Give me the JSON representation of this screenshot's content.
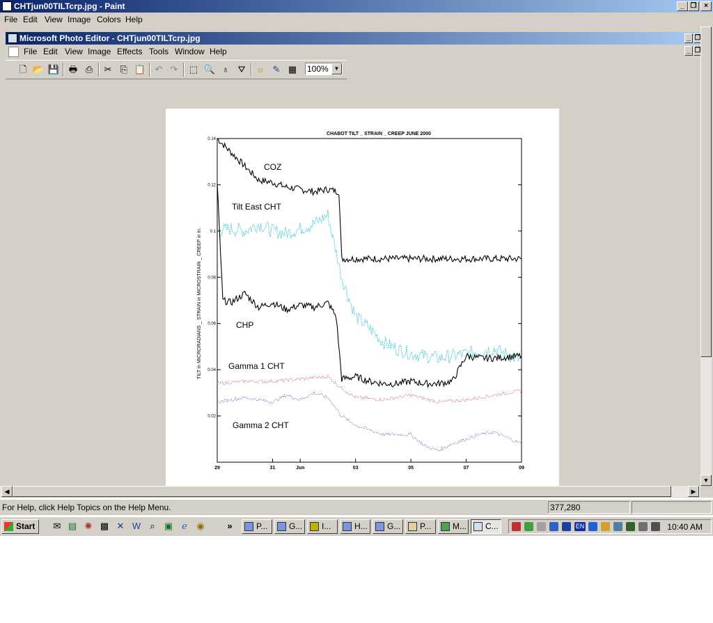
{
  "paint": {
    "title": "CHTjun00TILTcrp.jpg - Paint",
    "menu": [
      "File",
      "Edit",
      "View",
      "Image",
      "Colors",
      "Help"
    ]
  },
  "photo_editor": {
    "title": "Microsoft Photo Editor - CHTjun00TILTcrp.jpg",
    "menu": [
      "File",
      "Edit",
      "View",
      "Image",
      "Effects",
      "Tools",
      "Window",
      "Help"
    ],
    "zoom": "100%",
    "toolbar_icons": [
      "new-icon",
      "open-icon",
      "save-icon",
      "print-icon",
      "scan-icon",
      "cut-icon",
      "copy-icon",
      "paste-icon",
      "undo-icon",
      "redo-icon",
      "select-icon",
      "zoom-icon",
      "smudge-icon",
      "transparency-icon",
      "sharpen-icon",
      "pen-icon",
      "properties-icon"
    ]
  },
  "image": {
    "chart_data": {
      "type": "line",
      "title": "CHABOT TILT _ STRAIN _ CREEP   JUNE 2000",
      "ylabel": "TILT in MICRORADIANS _ STRAIN in MICROSTRAIN _ CREEP in in.",
      "xlabel": "",
      "ylim": [
        0,
        0.14
      ],
      "xlim": [
        29,
        39
      ],
      "yticks": [
        "0.14",
        "0.12",
        "0.1",
        "0.08",
        "0.06",
        "0.04",
        "0.02"
      ],
      "xticks": [
        {
          "x": 29,
          "label": "29"
        },
        {
          "x": 31,
          "label": "31"
        },
        {
          "x": 32,
          "label": "Jun"
        },
        {
          "x": 34,
          "label": "03"
        },
        {
          "x": 36,
          "label": "05"
        },
        {
          "x": 38,
          "label": "07"
        },
        {
          "x": 40,
          "label": "09"
        }
      ],
      "grid": false,
      "series": [
        {
          "name": "COZ",
          "color": "#000000",
          "style": "solid",
          "x": [
            29,
            29.5,
            30,
            30.5,
            31,
            31.5,
            32,
            32.5,
            33,
            33.4,
            33.5,
            34,
            35,
            36,
            37,
            38,
            39,
            40
          ],
          "y": [
            0.14,
            0.134,
            0.128,
            0.122,
            0.121,
            0.119,
            0.118,
            0.117,
            0.118,
            0.117,
            0.088,
            0.088,
            0.088,
            0.088,
            0.088,
            0.088,
            0.088,
            0.088
          ]
        },
        {
          "name": "Tilt East CHT",
          "color": "#40c8d8",
          "style": "dashed",
          "x": [
            29,
            29.5,
            30,
            30.5,
            31,
            31.5,
            32,
            32.5,
            33,
            33.5,
            34,
            34.5,
            35,
            35.5,
            36,
            36.5,
            37,
            37.5,
            38,
            38.5,
            39,
            40
          ],
          "y": [
            0.1,
            0.101,
            0.1,
            0.103,
            0.1,
            0.099,
            0.101,
            0.103,
            0.107,
            0.08,
            0.063,
            0.058,
            0.052,
            0.049,
            0.047,
            0.046,
            0.045,
            0.046,
            0.047,
            0.048,
            0.049,
            0.044
          ]
        },
        {
          "name": "CHP",
          "color": "#000000",
          "style": "solid",
          "x": [
            29,
            29.2,
            29.5,
            30,
            30.5,
            31,
            31.5,
            32,
            32.5,
            33,
            33.3,
            33.5,
            34,
            34.5,
            35,
            35.5,
            36,
            36.5,
            37,
            37.5,
            38,
            38.5,
            39,
            40
          ],
          "y": [
            0.12,
            0.07,
            0.069,
            0.073,
            0.067,
            0.069,
            0.066,
            0.068,
            0.067,
            0.069,
            0.063,
            0.036,
            0.037,
            0.035,
            0.034,
            0.034,
            0.035,
            0.034,
            0.034,
            0.035,
            0.046,
            0.045,
            0.045,
            0.046
          ]
        },
        {
          "name": "Gamma 1 CHT",
          "color": "#c04040",
          "style": "dotted",
          "x": [
            29,
            30,
            31,
            32,
            33,
            33.5,
            34,
            35,
            36,
            37,
            38,
            39,
            40
          ],
          "y": [
            0.034,
            0.035,
            0.035,
            0.036,
            0.037,
            0.032,
            0.028,
            0.027,
            0.029,
            0.026,
            0.027,
            0.029,
            0.031
          ]
        },
        {
          "name": "Gamma 2 CHT",
          "color": "#4050a0",
          "style": "dotted",
          "x": [
            29,
            30,
            31,
            31.5,
            32,
            32.5,
            33,
            33.5,
            34,
            35,
            36,
            36.5,
            37,
            37.5,
            38,
            38.5,
            39,
            40
          ],
          "y": [
            0.026,
            0.028,
            0.026,
            0.029,
            0.027,
            0.03,
            0.028,
            0.02,
            0.016,
            0.012,
            0.012,
            0.007,
            0.005,
            0.008,
            0.01,
            0.012,
            0.013,
            0.008
          ]
        }
      ],
      "annotations": [
        "COZ",
        "Tilt East CHT",
        "CHP",
        "Gamma 1 CHT",
        "Gamma 2 CHT"
      ]
    }
  },
  "status": {
    "help": "For Help, click Help Topics on the Help Menu.",
    "coords": "377,280",
    "extra": ""
  },
  "taskbar": {
    "start_label": "Start",
    "quick_launch_more": "»",
    "tasks": [
      {
        "label": "P...",
        "active": false
      },
      {
        "label": "G...",
        "active": false
      },
      {
        "label": "I...",
        "active": false
      },
      {
        "label": "H...",
        "active": false
      },
      {
        "label": "G...",
        "active": false
      },
      {
        "label": "P...",
        "active": false
      },
      {
        "label": "M...",
        "active": false
      },
      {
        "label": "C...",
        "active": true
      }
    ],
    "tray_lang": "EN",
    "clock": "10:40 AM"
  }
}
